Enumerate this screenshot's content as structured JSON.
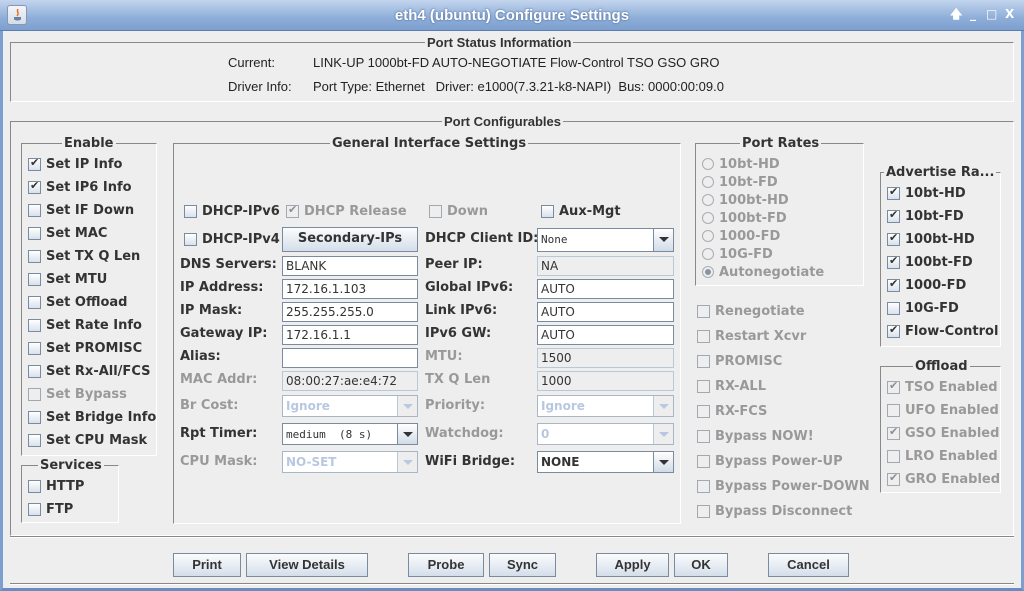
{
  "window": {
    "title": "eth4  (ubuntu) Configure Settings",
    "controls": {
      "pin": "🡅",
      "minimize": "_",
      "maximize": "□",
      "close": "X"
    }
  },
  "port_status": {
    "legend": "Port Status Information",
    "current_label": "Current:",
    "current_value": "LINK-UP 1000bt-FD AUTO-NEGOTIATE Flow-Control TSO GSO GRO",
    "driver_label": "Driver Info:",
    "driver_value": "Port Type: Ethernet   Driver: e1000(7.3.21-k8-NAPI)  Bus: 0000:00:09.0"
  },
  "port_configurables": {
    "legend": "Port Configurables"
  },
  "enable": {
    "legend": "Enable",
    "items": [
      {
        "label": "Set IP Info",
        "checked": true,
        "disabled": false
      },
      {
        "label": "Set IP6 Info",
        "checked": true,
        "disabled": false
      },
      {
        "label": "Set IF Down",
        "checked": false,
        "disabled": false
      },
      {
        "label": "Set MAC",
        "checked": false,
        "disabled": false
      },
      {
        "label": "Set TX Q Len",
        "checked": false,
        "disabled": false
      },
      {
        "label": "Set MTU",
        "checked": false,
        "disabled": false
      },
      {
        "label": "Set Offload",
        "checked": false,
        "disabled": false
      },
      {
        "label": "Set Rate Info",
        "checked": false,
        "disabled": false
      },
      {
        "label": "Set PROMISC",
        "checked": false,
        "disabled": false
      },
      {
        "label": "Set Rx-All/FCS",
        "checked": false,
        "disabled": false
      },
      {
        "label": "Set Bypass",
        "checked": false,
        "disabled": true
      },
      {
        "label": "Set Bridge Info",
        "checked": false,
        "disabled": false
      },
      {
        "label": "Set CPU Mask",
        "checked": false,
        "disabled": false
      }
    ]
  },
  "services": {
    "legend": "Services",
    "items": [
      {
        "label": "HTTP",
        "checked": false
      },
      {
        "label": "FTP",
        "checked": false
      }
    ]
  },
  "general": {
    "legend": "General Interface Settings",
    "dhcp_ipv6": {
      "label": "DHCP-IPv6",
      "checked": false
    },
    "dhcp_release": {
      "label": "DHCP Release",
      "checked": true,
      "disabled": true
    },
    "down": {
      "label": "Down",
      "checked": false,
      "disabled": true
    },
    "aux_mgt": {
      "label": "Aux-Mgt",
      "checked": false
    },
    "dhcp_ipv4": {
      "label": "DHCP-IPv4",
      "checked": false
    },
    "secondary_ips": "Secondary-IPs",
    "dhcp_client_id": {
      "label": "DHCP Client ID:",
      "value": "None"
    },
    "dns_servers": {
      "label": "DNS Servers:",
      "value": "BLANK"
    },
    "peer_ip": {
      "label": "Peer IP:",
      "value": "NA"
    },
    "ip_address": {
      "label": "IP Address:",
      "value": "172.16.1.103"
    },
    "global_ipv6": {
      "label": "Global IPv6:",
      "value": "AUTO"
    },
    "ip_mask": {
      "label": "IP Mask:",
      "value": "255.255.255.0"
    },
    "link_ipv6": {
      "label": "Link IPv6:",
      "value": "AUTO"
    },
    "gateway_ip": {
      "label": "Gateway IP:",
      "value": "172.16.1.1"
    },
    "ipv6_gw": {
      "label": "IPv6 GW:",
      "value": "AUTO"
    },
    "alias": {
      "label": "Alias:",
      "value": ""
    },
    "mtu": {
      "label": "MTU:",
      "value": "1500"
    },
    "mac_addr": {
      "label": "MAC Addr:",
      "value": "08:00:27:ae:e4:72"
    },
    "tx_q_len": {
      "label": "TX Q Len",
      "value": "1000"
    },
    "br_cost": {
      "label": "Br Cost:",
      "value": "Ignore"
    },
    "priority": {
      "label": "Priority:",
      "value": "Ignore"
    },
    "rpt_timer": {
      "label": "Rpt Timer:",
      "value": "medium  (8 s)"
    },
    "watchdog": {
      "label": "Watchdog:",
      "value": "0"
    },
    "cpu_mask": {
      "label": "CPU Mask:",
      "value": "NO-SET"
    },
    "wifi_bridge": {
      "label": "WiFi Bridge:",
      "value": "NONE"
    }
  },
  "port_rates": {
    "legend": "Port Rates",
    "options": [
      "10bt-HD",
      "10bt-FD",
      "100bt-HD",
      "100bt-FD",
      "1000-FD",
      "10G-FD",
      "Autonegotiate"
    ],
    "selected": "Autonegotiate"
  },
  "misc_options": [
    {
      "label": "Renegotiate",
      "checked": false
    },
    {
      "label": "Restart Xcvr",
      "checked": false
    },
    {
      "label": "PROMISC",
      "checked": false
    },
    {
      "label": "RX-ALL",
      "checked": false
    },
    {
      "label": "RX-FCS",
      "checked": false
    },
    {
      "label": "Bypass NOW!",
      "checked": false
    },
    {
      "label": "Bypass Power-UP",
      "checked": false
    },
    {
      "label": "Bypass Power-DOWN",
      "checked": false
    },
    {
      "label": "Bypass Disconnect",
      "checked": false
    }
  ],
  "advertise": {
    "legend": "Advertise Ra...",
    "items": [
      {
        "label": "10bt-HD",
        "checked": true
      },
      {
        "label": "10bt-FD",
        "checked": true
      },
      {
        "label": "100bt-HD",
        "checked": true
      },
      {
        "label": "100bt-FD",
        "checked": true
      },
      {
        "label": "1000-FD",
        "checked": true
      },
      {
        "label": "10G-FD",
        "checked": false
      },
      {
        "label": "Flow-Control",
        "checked": true
      }
    ]
  },
  "offload": {
    "legend": "Offload",
    "items": [
      {
        "label": "TSO Enabled",
        "checked": true
      },
      {
        "label": "UFO Enabled",
        "checked": false
      },
      {
        "label": "GSO Enabled",
        "checked": true
      },
      {
        "label": "LRO Enabled",
        "checked": false
      },
      {
        "label": "GRO Enabled",
        "checked": true
      }
    ]
  },
  "buttons": {
    "print": "Print",
    "view_details": "View Details",
    "probe": "Probe",
    "sync": "Sync",
    "apply": "Apply",
    "ok": "OK",
    "cancel": "Cancel"
  }
}
